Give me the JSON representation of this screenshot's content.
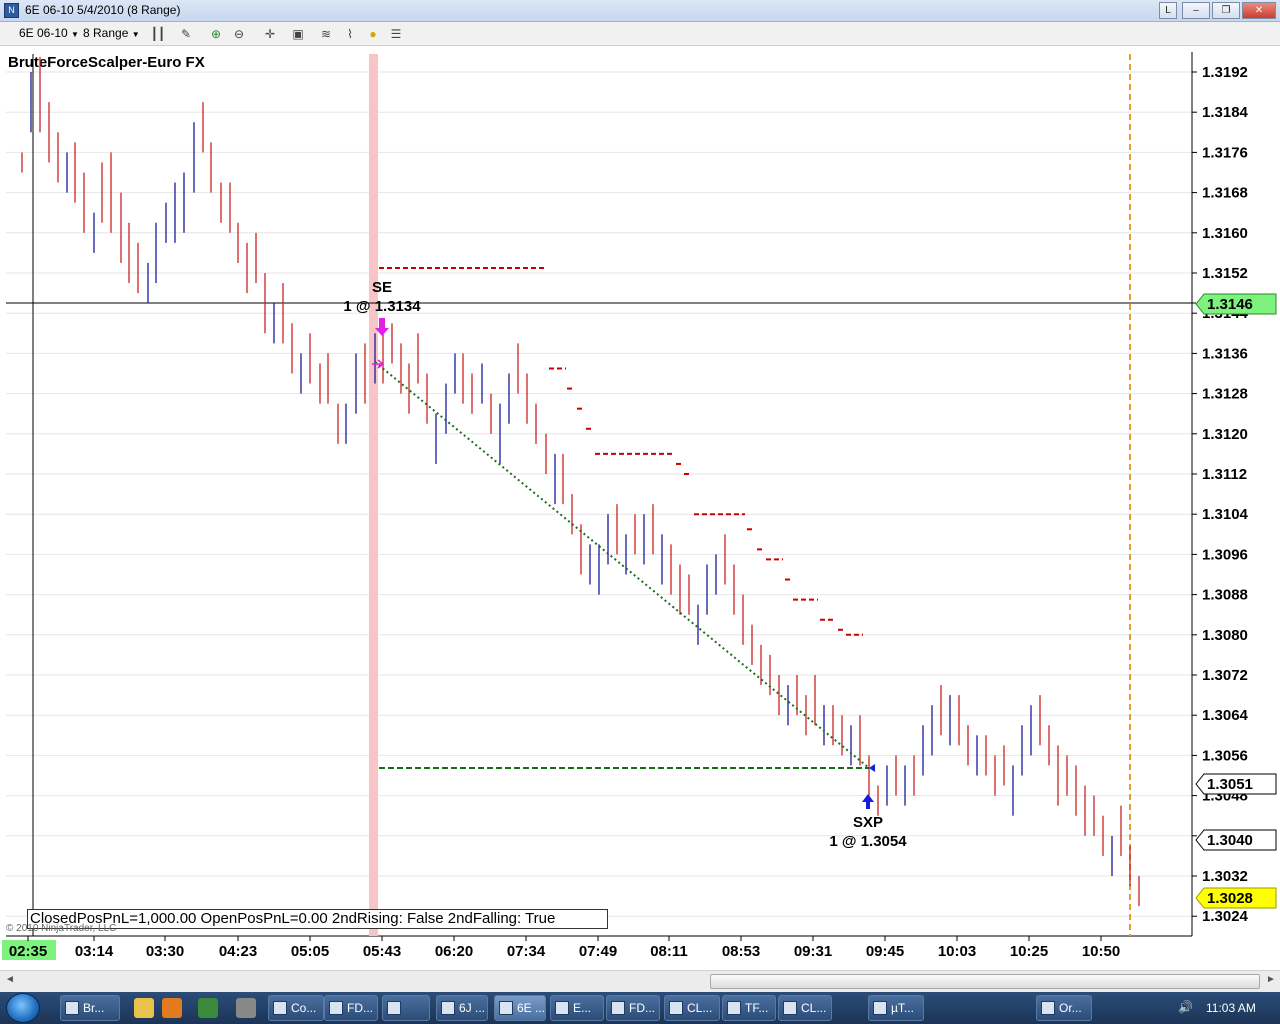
{
  "window": {
    "title": "6E 06-10  5/4/2010 (8 Range)",
    "buttons": [
      "L",
      "–",
      "❐",
      "✕"
    ]
  },
  "toolbar": {
    "instrument": "6E 06-10",
    "period": "8 Range"
  },
  "chart": {
    "indicator_label": "BruteForceScalper-Euro FX",
    "copyright": "© 2010 NinjaTrader, LLC",
    "status_text": "ClosedPosPnL=1,000.00 OpenPosPnL=0.00 2ndRising: False 2ndFalling: True",
    "y_axis_labels": [
      "1.3192",
      "1.3184",
      "1.3176",
      "1.3168",
      "1.3160",
      "1.3152",
      "1.3144",
      "1.3136",
      "1.3128",
      "1.3120",
      "1.3112",
      "1.3104",
      "1.3096",
      "1.3088",
      "1.3080",
      "1.3072",
      "1.3064",
      "1.3056",
      "1.3048",
      "1.3040",
      "1.3032",
      "1.3024"
    ],
    "x_axis_labels": [
      "02:35",
      "03:14",
      "03:30",
      "04:23",
      "05:05",
      "05:43",
      "06:20",
      "07:34",
      "07:49",
      "08:11",
      "08:53",
      "09:31",
      "09:45",
      "10:03",
      "10:25",
      "10:50"
    ],
    "price_flags": {
      "crosshair": "1.3146",
      "level1": "1.3051",
      "level2": "1.3040",
      "last": "1.3028"
    },
    "entry": {
      "label": "SE",
      "detail": "1 @ 1.3134"
    },
    "exit": {
      "label": "SXP",
      "detail": "1 @ 1.3054"
    },
    "colors": {
      "up_bar": "#1a1a9c",
      "down_bar": "#cc2222",
      "stop": "#cc0000",
      "target": "#1a6e1a",
      "highlight": "#f7c5c5",
      "last_flag": "#ffff00",
      "crosshair_flag": "#7ef27e"
    }
  },
  "taskbar": {
    "tasks": [
      "Br...",
      "Co...",
      "FD...",
      "",
      "6J ...",
      "6E ...",
      "E...",
      "FD...",
      "CL...",
      "TF...",
      "CL...",
      "µT...",
      "Or..."
    ],
    "clock": "11:03 AM"
  }
}
